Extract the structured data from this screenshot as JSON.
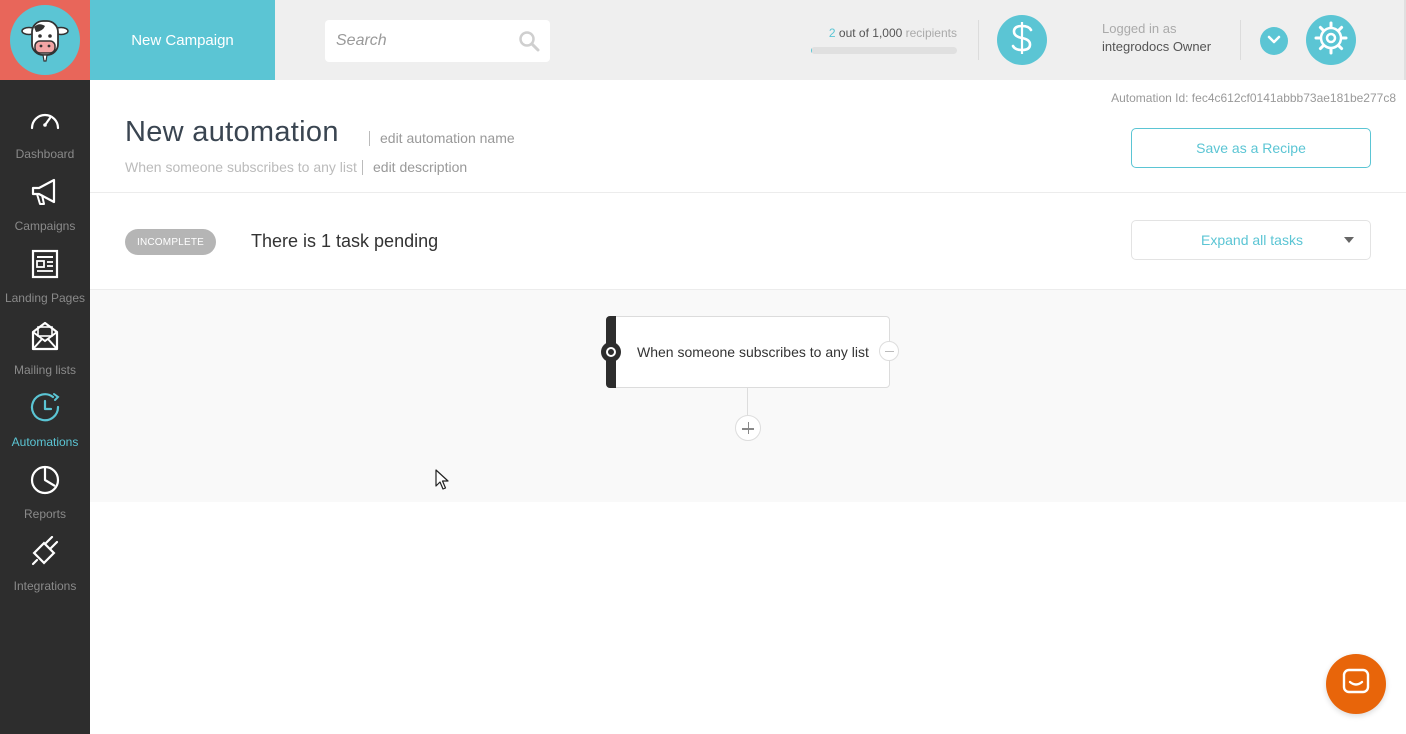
{
  "header": {
    "new_campaign_label": "New Campaign",
    "search_placeholder": "Search",
    "recipients": {
      "count": "2",
      "middle": " out of ",
      "total": "1,000",
      "suffix": " recipients",
      "used_fraction": 0.002
    },
    "logged_in_label": "Logged in as",
    "user_name": "integrodocs Owner"
  },
  "sidebar": {
    "items": [
      {
        "label": "Dashboard",
        "icon": "speedometer-icon",
        "active": false
      },
      {
        "label": "Campaigns",
        "icon": "megaphone-icon",
        "active": false
      },
      {
        "label": "Landing Pages",
        "icon": "landing-page-icon",
        "active": false
      },
      {
        "label": "Mailing lists",
        "icon": "envelope-icon",
        "active": false
      },
      {
        "label": "Automations",
        "icon": "clock-icon",
        "active": true
      },
      {
        "label": "Reports",
        "icon": "pie-chart-icon",
        "active": false
      },
      {
        "label": "Integrations",
        "icon": "plug-icon",
        "active": false
      }
    ]
  },
  "main": {
    "automation_id": "Automation Id: fec4c612cf0141abbb73ae181be277c8",
    "title": "New automation",
    "edit_name_label": "edit automation name",
    "description": "When someone subscribes to any list",
    "edit_description_label": "edit description",
    "save_recipe_label": "Save as a Recipe",
    "status_badge": "INCOMPLETE",
    "pending_text": "There is 1 task pending",
    "expand_label": "Expand all tasks",
    "trigger_text": "When someone subscribes to any list"
  },
  "colors": {
    "accent": "#5bc5d4",
    "logo_bg": "#e8665a",
    "sidebar_bg": "#2d2d2d",
    "chat": "#e8650a"
  }
}
